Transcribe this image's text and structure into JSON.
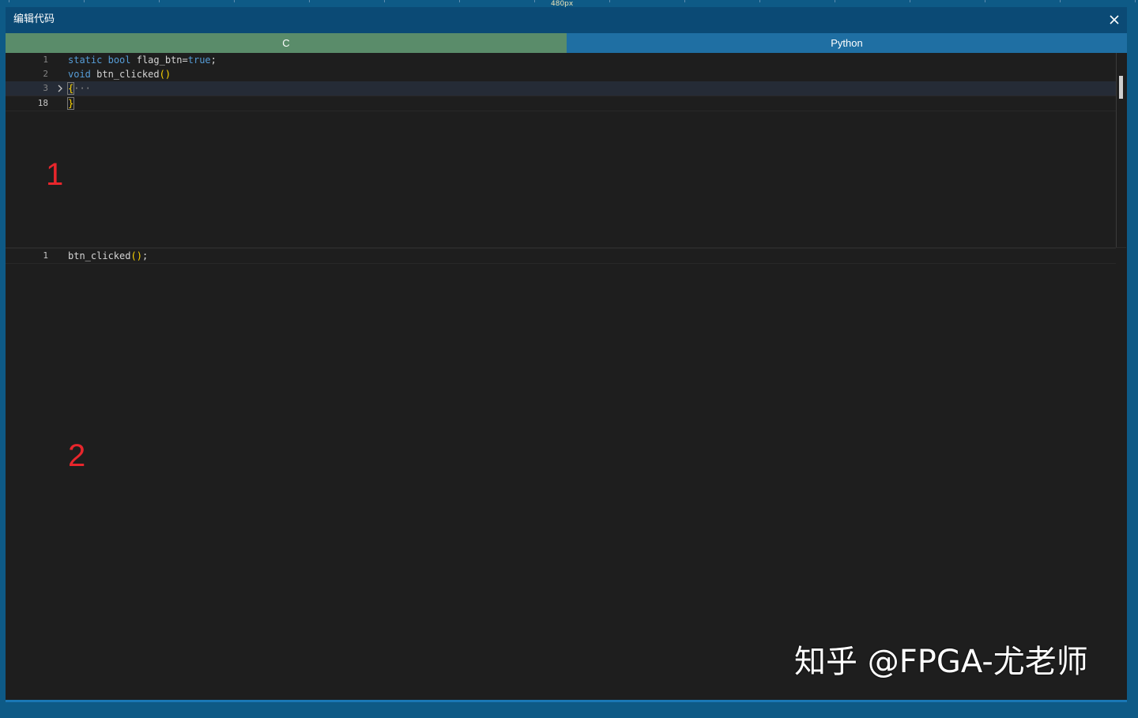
{
  "ruler": {
    "label": "480px"
  },
  "window": {
    "title": "编辑代码"
  },
  "tabs": [
    {
      "label": "C",
      "active": true
    },
    {
      "label": "Python",
      "active": false
    }
  ],
  "editor1": {
    "lines": [
      {
        "num": "1"
      },
      {
        "num": "2"
      },
      {
        "num": "3"
      },
      {
        "num": "18"
      }
    ],
    "tokens": {
      "static": "static",
      "bool": "bool",
      "flag": " flag_btn=",
      "true": "true",
      "semi": ";",
      "void": "void",
      "fname": " btn_clicked",
      "parens": "()",
      "open_brace": "{",
      "ellipsis": "···",
      "close_brace": "}"
    }
  },
  "editor2": {
    "lines": [
      {
        "num": "1"
      }
    ],
    "tokens": {
      "call": "btn_clicked",
      "parens": "()",
      "semi": ";"
    }
  },
  "markers": {
    "one": "1",
    "two": "2"
  },
  "watermark": "知乎 @FPGA-尤老师",
  "colors": {
    "titlebar": "#0b4a75",
    "tab_active": "#5a8c6a",
    "tab_inactive": "#1f6fa3",
    "editor_bg": "#1e1e1e",
    "keyword": "#569cd6",
    "bracket": "#ffd700",
    "marker": "#e8262c"
  },
  "icons": {
    "close": "close-icon",
    "fold": "chevron-right-icon"
  }
}
